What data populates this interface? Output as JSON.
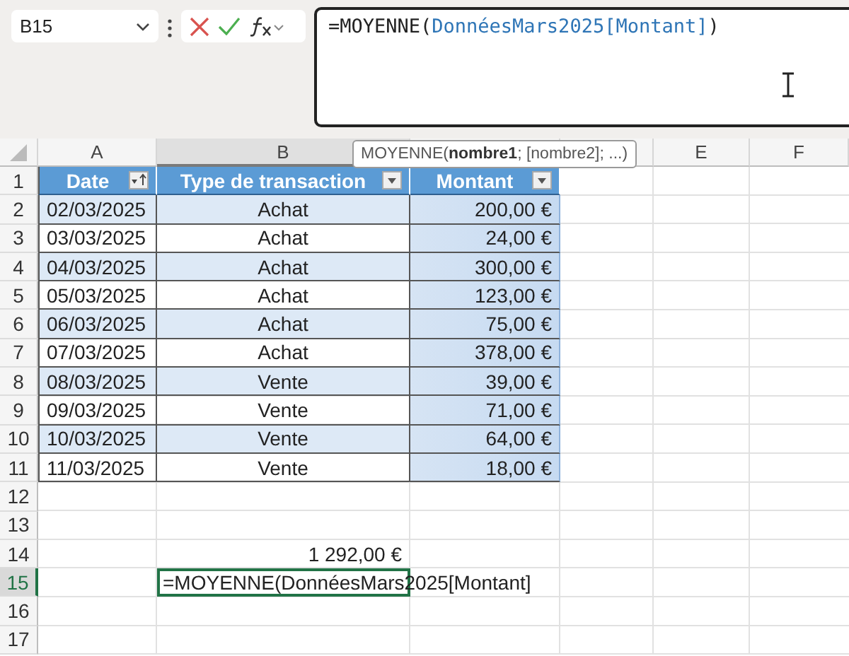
{
  "name_box": "B15",
  "formula_bar": {
    "parts": [
      {
        "kind": "plain",
        "text": "=MOYENNE("
      },
      {
        "kind": "reference",
        "text": "DonnéesMars2025[Montant]"
      },
      {
        "kind": "plain",
        "text": ")"
      }
    ]
  },
  "tooltip": "MOYENNE(**nombre1**; [nombre2]; ...)",
  "column_headers": [
    {
      "label": "A",
      "selected": false
    },
    {
      "label": "B",
      "selected": true
    },
    {
      "label": "E",
      "selected": false
    },
    {
      "label": "F",
      "selected": false
    }
  ],
  "row_headers": [
    {
      "label": "1",
      "selected": false
    },
    {
      "label": "2",
      "selected": false
    },
    {
      "label": "3",
      "selected": false
    },
    {
      "label": "4",
      "selected": false
    },
    {
      "label": "5",
      "selected": false
    },
    {
      "label": "6",
      "selected": false
    },
    {
      "label": "7",
      "selected": false
    },
    {
      "label": "8",
      "selected": false
    },
    {
      "label": "9",
      "selected": false
    },
    {
      "label": "10",
      "selected": false
    },
    {
      "label": "11",
      "selected": false
    },
    {
      "label": "12",
      "selected": false
    },
    {
      "label": "13",
      "selected": false
    },
    {
      "label": "14",
      "selected": false
    },
    {
      "label": "15",
      "selected": true
    },
    {
      "label": "16",
      "selected": false
    },
    {
      "label": "17",
      "selected": false
    }
  ],
  "table": {
    "columns": [
      {
        "label": "Date",
        "sorted": true,
        "highlighted": false
      },
      {
        "label": "Type de transaction",
        "sorted": false,
        "highlighted": false
      },
      {
        "label": "Montant",
        "sorted": false,
        "highlighted": true
      }
    ],
    "rows": [
      [
        "02/03/2025",
        "Achat",
        "200,00 €"
      ],
      [
        "03/03/2025",
        "Achat",
        "24,00 €"
      ],
      [
        "04/03/2025",
        "Achat",
        "300,00 €"
      ],
      [
        "05/03/2025",
        "Achat",
        "123,00 €"
      ],
      [
        "06/03/2025",
        "Achat",
        "75,00 €"
      ],
      [
        "07/03/2025",
        "Achat",
        "378,00 €"
      ],
      [
        "08/03/2025",
        "Vente",
        "39,00 €"
      ],
      [
        "09/03/2025",
        "Vente",
        "71,00 €"
      ],
      [
        "10/03/2025",
        "Vente",
        "64,00 €"
      ],
      [
        "11/03/2025",
        "Vente",
        "18,00 €"
      ]
    ]
  },
  "total_cell": "1 292,00 €",
  "editing_cell": "=MOYENNE(DonnéesMars2025[Montant]"
}
